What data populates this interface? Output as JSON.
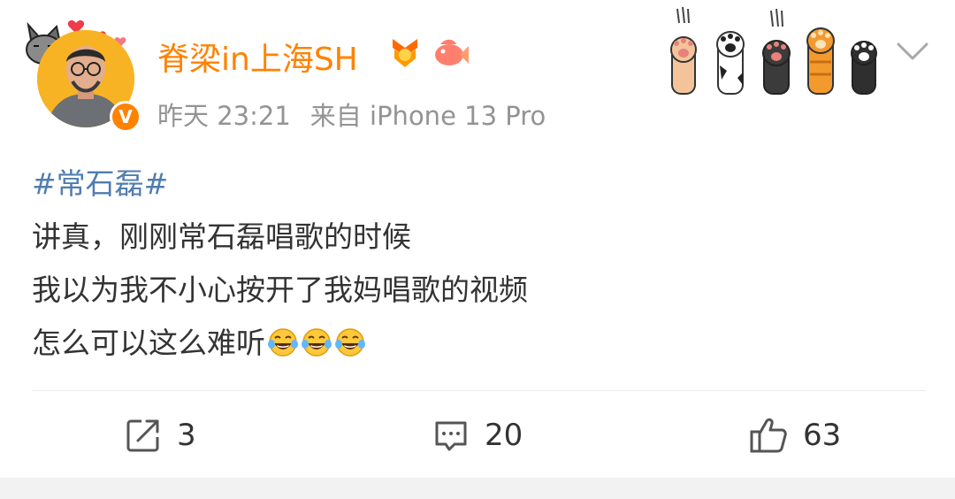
{
  "header": {
    "username": "脊梁in上海SH",
    "time": "昨天 23:21",
    "source": "来自 iPhone 13 Pro",
    "verified_badge": "V"
  },
  "post": {
    "topic": "#常石磊#",
    "lines": [
      "讲真，刚刚常石磊唱歌的时候",
      "我以为我不小心按开了我妈唱歌的视频",
      "怎么可以这么难听"
    ],
    "emojis": [
      "laughing-tears-emoji",
      "laughing-tears-emoji",
      "laughing-tears-emoji"
    ]
  },
  "actions": {
    "repost_count": "3",
    "comment_count": "20",
    "like_count": "63"
  },
  "colors": {
    "username": "#ff8200",
    "topic": "#507daf",
    "meta": "#939393",
    "text": "#333333"
  },
  "icons": [
    "cat-avatar-decoration",
    "verified-icon",
    "medal-badge-icon",
    "fish-badge-icon",
    "cat-paws-decoration",
    "chevron-down-icon",
    "repost-icon",
    "comment-icon",
    "like-icon"
  ]
}
